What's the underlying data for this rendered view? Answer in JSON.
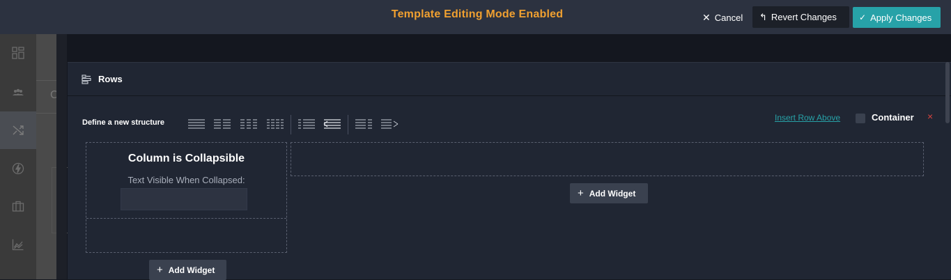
{
  "topbar": {
    "title": "Template Editing Mode Enabled",
    "cancel_label": "Cancel",
    "revert_label": "Revert Changes",
    "apply_label": "Apply Changes",
    "title_color": "#f0a030",
    "apply_color": "#27a2a8"
  },
  "leftnav": {
    "items": [
      {
        "icon": "dashboard-icon"
      },
      {
        "icon": "users-icon"
      },
      {
        "icon": "shuffle-icon",
        "active": true
      },
      {
        "icon": "lightning-icon"
      },
      {
        "icon": "briefcase-icon"
      },
      {
        "icon": "chart-icon"
      }
    ],
    "partial_tab_text": "C"
  },
  "panel": {
    "title": "Rows",
    "structure_label": "Define a new structure",
    "layouts": [
      "layout-1-col-icon",
      "layout-2-col-icon",
      "layout-3-col-icon",
      "layout-4-col-icon",
      "layout-left-narrow-icon",
      "layout-right-narrow-icon",
      "layout-wide-left-icon",
      "layout-wide-right-icon"
    ],
    "insert_row_label": "Insert Row Above",
    "container_label": "Container",
    "container_checked": false,
    "remove_label": "×",
    "left_column": {
      "title": "Column is Collapsible",
      "collapsed_label": "Text Visible When Collapsed:",
      "collapsed_value": "",
      "add_widget_label": "Add Widget"
    },
    "right_column": {
      "add_widget_label": "Add Widget"
    }
  }
}
